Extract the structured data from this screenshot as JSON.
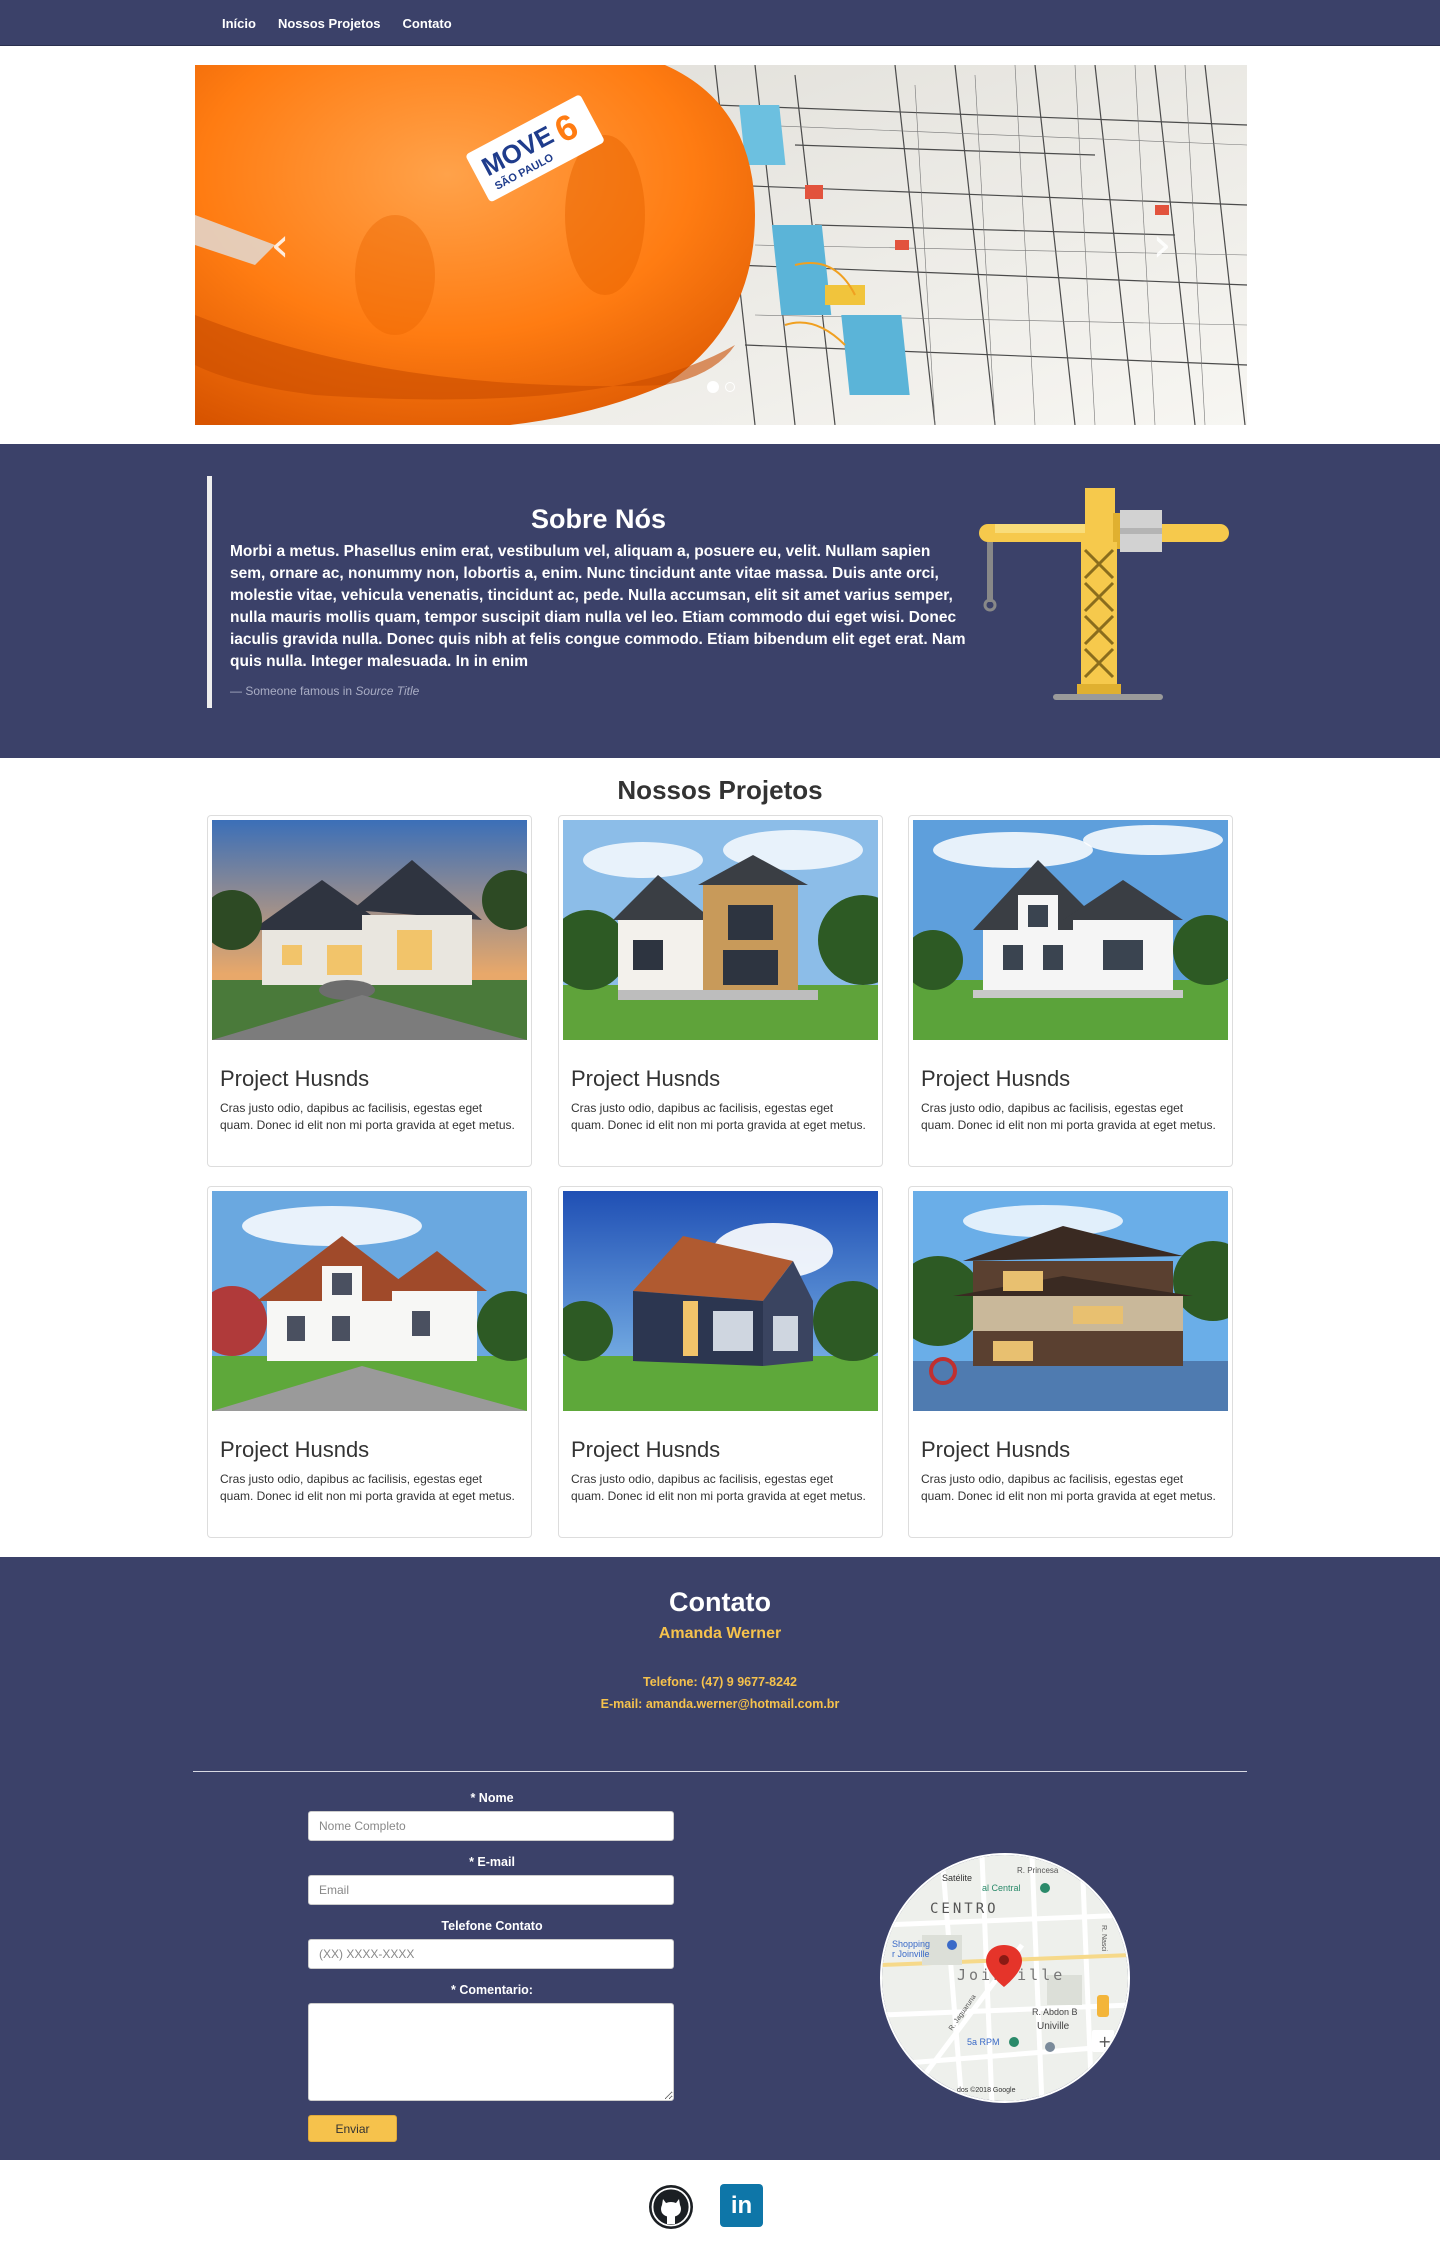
{
  "nav": {
    "items": [
      {
        "label": "Início"
      },
      {
        "label": "Nossos Projetos"
      },
      {
        "label": "Contato"
      }
    ]
  },
  "carousel": {
    "prev_icon": "chevron-left-icon",
    "next_icon": "chevron-right-icon",
    "slide_count": 2,
    "active_slide": 1,
    "helmet_logo": "MOVE6 SÃO PAULO"
  },
  "about": {
    "title": "Sobre Nós",
    "text": "Morbi a metus. Phasellus enim erat, vestibulum vel, aliquam a, posuere eu, velit. Nullam sapien sem, ornare ac, nonummy non, lobortis a, enim. Nunc tincidunt ante vitae massa. Duis ante orci, molestie vitae, vehicula venenatis, tincidunt ac, pede. Nulla accumsan, elit sit amet varius semper, nulla mauris mollis quam, tempor suscipit diam nulla vel leo. Etiam commodo dui eget wisi. Donec iaculis gravida nulla. Donec quis nibh at felis congue commodo. Etiam bibendum elit eget erat. Nam quis nulla. Integer malesuada. In in enim",
    "cite_prefix": "— Someone famous in ",
    "cite_source": "Source Title"
  },
  "projects": {
    "title": "Nossos Projetos",
    "items": [
      {
        "title": "Project Husnds",
        "text": "Cras justo odio, dapibus ac facilisis, egestas eget quam. Donec id elit non mi porta gravida at eget metus."
      },
      {
        "title": "Project Husnds",
        "text": "Cras justo odio, dapibus ac facilisis, egestas eget quam. Donec id elit non mi porta gravida at eget metus."
      },
      {
        "title": "Project Husnds",
        "text": "Cras justo odio, dapibus ac facilisis, egestas eget quam. Donec id elit non mi porta gravida at eget metus."
      },
      {
        "title": "Project Husnds",
        "text": "Cras justo odio, dapibus ac facilisis, egestas eget quam. Donec id elit non mi porta gravida at eget metus."
      },
      {
        "title": "Project Husnds",
        "text": "Cras justo odio, dapibus ac facilisis, egestas eget quam. Donec id elit non mi porta gravida at eget metus."
      },
      {
        "title": "Project Husnds",
        "text": "Cras justo odio, dapibus ac facilisis, egestas eget quam. Donec id elit non mi porta gravida at eget metus."
      }
    ]
  },
  "contact": {
    "title": "Contato",
    "name": "Amanda Werner",
    "phone": "Telefone: (47) 9 9677-8242",
    "email": "E-mail: amanda.werner@hotmail.com.br",
    "form": {
      "name_label": "* Nome",
      "name_placeholder": "Nome Completo",
      "email_label": "* E-mail",
      "email_placeholder": "Email",
      "phone_label": "Telefone Contato",
      "phone_placeholder": "(XX) XXXX-XXXX",
      "comment_label": "* Comentario:",
      "submit_label": "Enviar"
    },
    "map": {
      "satellite": "Satélite",
      "street_top": "R. Princesa",
      "central": "al Central",
      "district": "CENTRO",
      "shopping": "Shopping",
      "shopping2": "r Joinville",
      "city": "Joinville",
      "abdon": "R. Abdon B",
      "univille": "Univille",
      "rpm": "5a RPM",
      "copyright": "dos ©2018 Google",
      "street_left": "R. Jaguaruna",
      "street_right": "R. Nasci"
    }
  },
  "footer": {
    "github_icon": "github-icon",
    "linkedin_label": "in"
  },
  "colors": {
    "navy": "#3b4169",
    "accent": "#f6c24c"
  }
}
